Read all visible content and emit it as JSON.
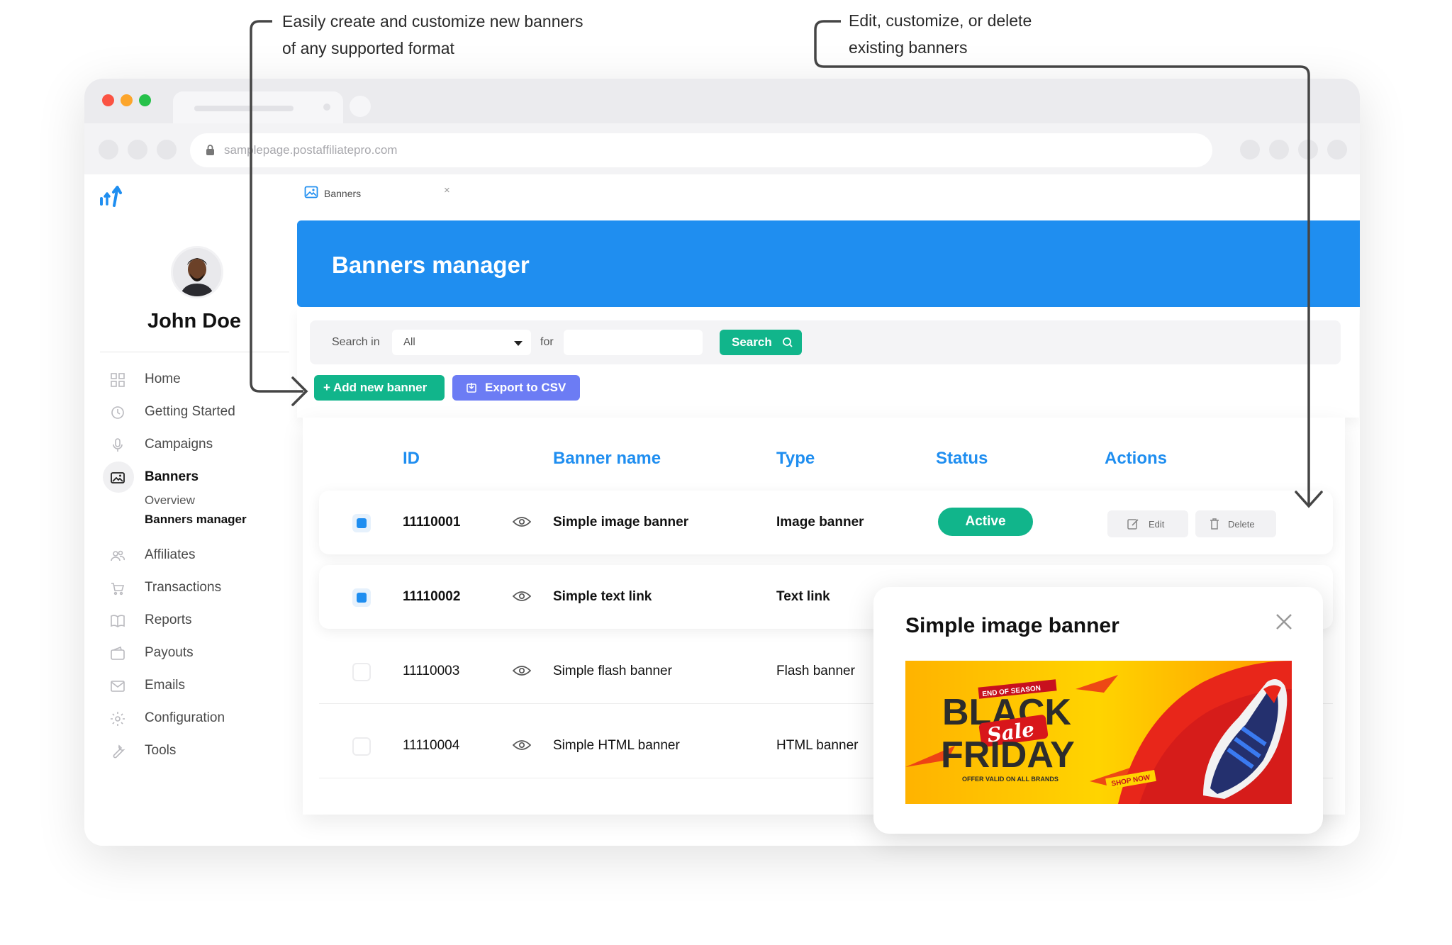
{
  "annotations": {
    "left_line1": "Easily create and customize new banners",
    "left_line2": "of any supported format",
    "right_line1": "Edit, customize, or delete",
    "right_line2": "existing banners"
  },
  "browser": {
    "url": "samplepage.postaffiliatepro.com"
  },
  "app_tab": {
    "label": "Banners",
    "close": "×"
  },
  "user": {
    "name": "John Doe"
  },
  "sidebar": {
    "items": [
      {
        "label": "Home",
        "icon": "grid-icon"
      },
      {
        "label": "Getting Started",
        "icon": "clock-icon"
      },
      {
        "label": "Campaigns",
        "icon": "microphone-icon"
      },
      {
        "label": "Banners",
        "icon": "image-icon"
      },
      {
        "label": "Affiliates",
        "icon": "users-icon"
      },
      {
        "label": "Transactions",
        "icon": "cart-icon"
      },
      {
        "label": "Reports",
        "icon": "book-icon"
      },
      {
        "label": "Payouts",
        "icon": "wallet-icon"
      },
      {
        "label": "Emails",
        "icon": "mail-icon"
      },
      {
        "label": "Configuration",
        "icon": "gear-icon"
      },
      {
        "label": "Tools",
        "icon": "wrench-icon"
      }
    ],
    "banners_sub": [
      "Overview",
      "Banners manager"
    ]
  },
  "header": {
    "title": "Banners manager"
  },
  "filter": {
    "search_in_label": "Search in",
    "select_value": "All",
    "for_label": "for",
    "search_value": "",
    "search_button": "Search",
    "add_button": "+ Add new banner",
    "export_button": "Export to CSV"
  },
  "table": {
    "columns": [
      "ID",
      "Banner name",
      "Type",
      "Status",
      "Actions"
    ],
    "rows": [
      {
        "id": "11110001",
        "name": "Simple image banner",
        "type": "Image banner",
        "status": "Active",
        "selected": true
      },
      {
        "id": "11110002",
        "name": "Simple text link",
        "type": "Text link",
        "status": "",
        "selected": true
      },
      {
        "id": "11110003",
        "name": "Simple flash banner",
        "type": "Flash banner",
        "status": "",
        "selected": false
      },
      {
        "id": "11110004",
        "name": "Simple HTML banner",
        "type": "HTML banner",
        "status": "",
        "selected": false
      }
    ],
    "edit_label": "Edit",
    "delete_label": "Delete"
  },
  "preview": {
    "title": "Simple image banner",
    "banner": {
      "tag": "END OF SEASON",
      "line1": "BLACK",
      "sale": "Sale",
      "line2": "FRIDAY",
      "offer": "OFFER VALID ON ALL BRANDS",
      "cta": "SHOP NOW"
    }
  },
  "colors": {
    "brand_blue": "#1f8ef0",
    "green": "#11b58b",
    "purple": "#6c7cf4"
  }
}
